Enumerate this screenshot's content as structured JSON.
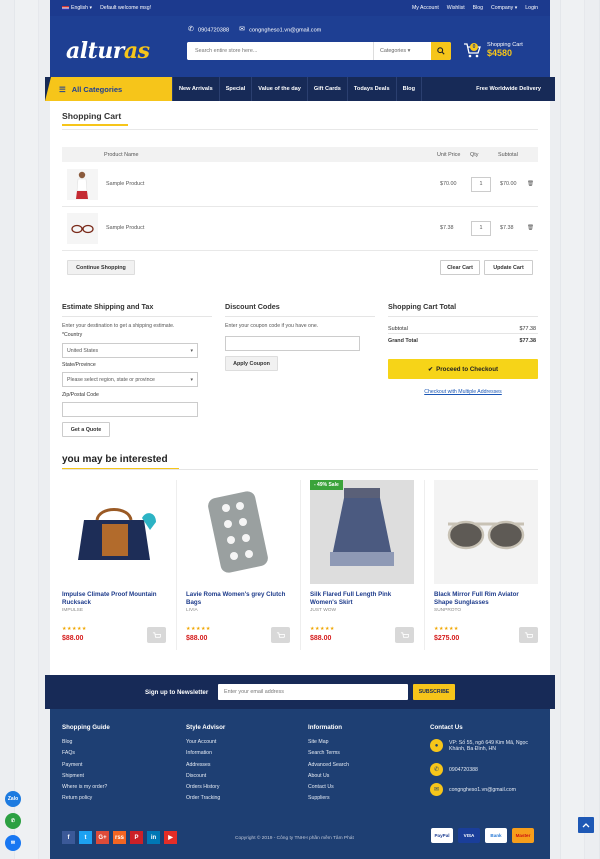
{
  "topbar": {
    "language": "English",
    "welcome": "Default welcome msg!",
    "links": [
      "My Account",
      "Wishlist",
      "Blog",
      "Company",
      "Login"
    ]
  },
  "header": {
    "logo_main": "altur",
    "logo_accent": "as",
    "phone": "0904720388",
    "email": "congngheso1.vn@gmail.com",
    "search_placeholder": "Search entire store here...",
    "categories": "Categories",
    "cart_label": "Shopping Cart",
    "cart_total": "$4580",
    "cart_count": "0"
  },
  "nav": {
    "all_categories": "All Categories",
    "items": [
      "New Arrivals",
      "Special",
      "Value of the day",
      "Gift Cards",
      "Todays Deals",
      "Blog"
    ],
    "shipping": "Free Worldwide Delivery"
  },
  "cart": {
    "title": "Shopping Cart",
    "headers": {
      "name": "Product Name",
      "unit": "Unit Price",
      "qty": "Qty",
      "subtotal": "Subtotal"
    },
    "rows": [
      {
        "name": "Sample Product",
        "unit": "$70.00",
        "qty": "1",
        "subtotal": "$70.00"
      },
      {
        "name": "Sample Product",
        "unit": "$7.38",
        "qty": "1",
        "subtotal": "$7.38"
      }
    ],
    "continue": "Continue Shopping",
    "clear": "Clear Cart",
    "update": "Update Cart"
  },
  "estimate": {
    "title": "Estimate Shipping and Tax",
    "desc": "Enter your destination to get a shipping estimate.",
    "country_label": "*Country",
    "country": "United States",
    "state_label": "State/Province",
    "state": "Please select region, state or province",
    "zip_label": "Zip/Postal Code",
    "quote": "Get a Quote"
  },
  "discount": {
    "title": "Discount Codes",
    "desc": "Enter your coupon code if you have one.",
    "apply": "Apply Coupon"
  },
  "totals": {
    "title": "Shopping Cart Total",
    "subtotal_label": "Subtotal",
    "subtotal": "$77.38",
    "grand_label": "Grand Total",
    "grand": "$77.38",
    "checkout": "Proceed to Checkout",
    "multi": "Checkout with Multiple Addresses"
  },
  "interested": {
    "title": "you may be interested",
    "products": [
      {
        "name": "Impulse Climate Proof Mountain Rucksack",
        "brand": "IMPULSE",
        "price": "$88.00",
        "stars": "★★★★★"
      },
      {
        "name": "Lavie Roma Women's grey Clutch Bags",
        "brand": "LIVIA",
        "price": "$88.00",
        "stars": "★★★★★"
      },
      {
        "name": "Silk Flared Full Length Pink Women's Skirt",
        "brand": "JUST WOW",
        "price": "$88.00",
        "stars": "★★★★★",
        "badge": "- 49% Sale"
      },
      {
        "name": "Black Mirror Full Rim Aviator Shape Sunglasses",
        "brand": "SUNPROTO",
        "price": "$275.00",
        "stars": "★★★★★"
      }
    ]
  },
  "newsletter": {
    "label": "Sign up to Newsletter",
    "placeholder": "Enter your email address",
    "button": "SUBSCRIBE"
  },
  "footer": {
    "guide": {
      "title": "Shopping Guide",
      "items": [
        "Blog",
        "FAQs",
        "Payment",
        "Shipment",
        "Where is my order?",
        "Return policy"
      ]
    },
    "advisor": {
      "title": "Style Advisor",
      "items": [
        "Your Account",
        "Information",
        "Addresses",
        "Discount",
        "Orders History",
        "Order Tracking"
      ]
    },
    "info": {
      "title": "Information",
      "items": [
        "Site Map",
        "Search Terms",
        "Advanced Search",
        "About Us",
        "Contact Us",
        "Suppliers"
      ]
    },
    "contact": {
      "title": "Contact Us",
      "address": "VP: Số 55, ngõ 649 Kim Mã, Ngọc Khánh, Ba Đình, HN",
      "phone": "0904720388",
      "email": "congngheso1.vn@gmail.com"
    },
    "copyright": "Copyright © 2019 - Công ty TNHH phần mềm Tâm Phát",
    "payments": [
      "PayPal",
      "VISA",
      "Bank",
      "Master"
    ],
    "social": [
      "f",
      "t",
      "G+",
      "rss",
      "P",
      "in",
      "▶"
    ]
  },
  "floats": {
    "zalo": "Zalo"
  }
}
